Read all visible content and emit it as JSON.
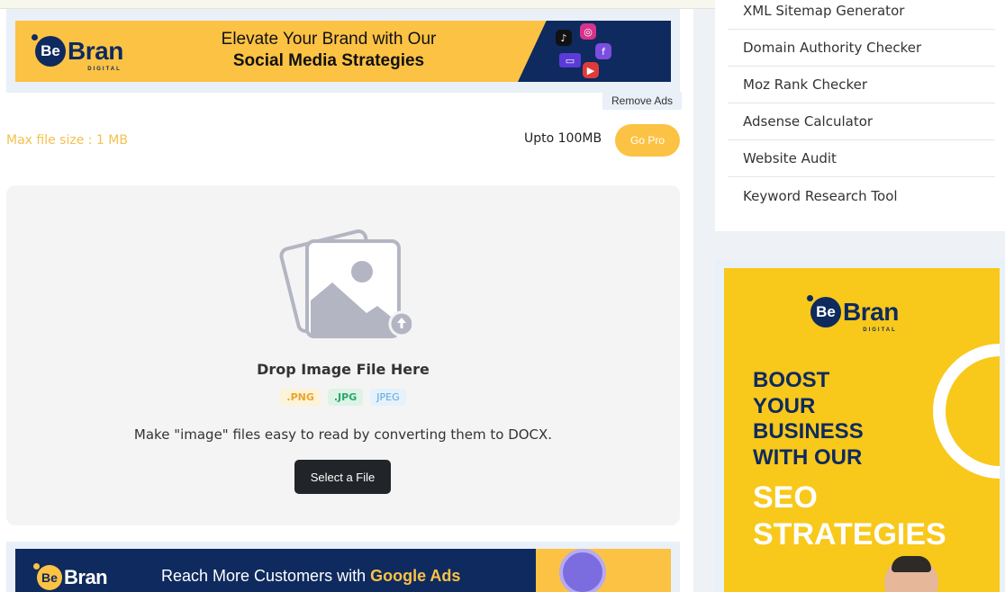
{
  "ad_top": {
    "logo_be": "Be",
    "logo_bran": "Bran",
    "logo_sub": "DIGITAL",
    "line1": "Elevate Your Brand with Our",
    "line2": "Social Media Strategies"
  },
  "remove_ads_label": "Remove Ads",
  "limits": {
    "max_size": "Max file size : 1 MB",
    "upto": "Upto 100MB",
    "go_pro_label": "Go Pro"
  },
  "dropzone": {
    "title": "Drop Image File Here",
    "formats": [
      ".PNG",
      ".JPG",
      "JPEG"
    ],
    "description": "Make \"image\" files easy to read by converting them to DOCX.",
    "select_label": "Select a File"
  },
  "ad_bottom": {
    "logo_be": "Be",
    "logo_bran": "Bran",
    "logo_sub": "DIGITAL",
    "text_prefix": "Reach More Customers with ",
    "text_highlight": "Google Ads"
  },
  "sidebar": {
    "items": [
      "XML Sitemap Generator",
      "Domain Authority Checker",
      "Moz Rank Checker",
      "Adsense Calculator",
      "Website Audit",
      "Keyword Research Tool"
    ]
  },
  "ad_side": {
    "logo_be": "Be",
    "logo_bran": "Bran",
    "logo_sub": "DIGITAL",
    "boost_lines": [
      "BOOST",
      "YOUR",
      "BUSINESS",
      "WITH OUR"
    ],
    "seo_lines": [
      "SEO",
      "STRATEGIES"
    ]
  },
  "colors": {
    "accent_yellow": "#fcc244",
    "brand_navy": "#0e2a5e",
    "button_dark": "#212529"
  }
}
